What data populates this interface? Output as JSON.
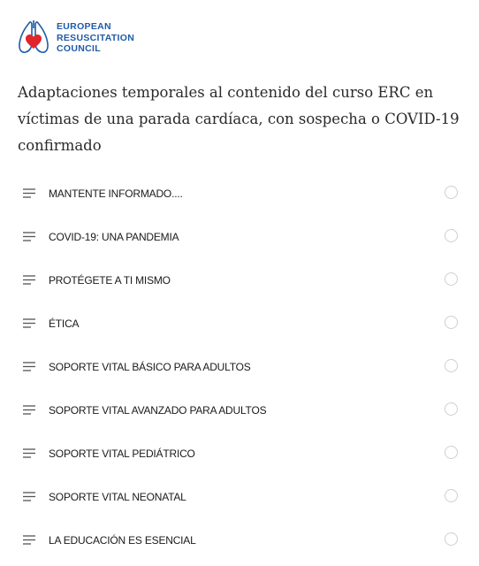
{
  "brand": {
    "line1": "EUROPEAN",
    "line2": "RESUSCITATION",
    "line3": "COUNCIL",
    "brand_color": "#1e5ba8",
    "heart_color": "#e0262b"
  },
  "course": {
    "title": "Adaptaciones temporales al contenido del curso ERC en víctimas de una parada cardíaca, con sospecha o COVID-19 confirmado"
  },
  "lessons": [
    {
      "label": "MANTENTE INFORMADO....",
      "icon": "lesson-lines-icon",
      "status": "incomplete"
    },
    {
      "label": "COVID-19: UNA PANDEMIA",
      "icon": "lesson-lines-icon",
      "status": "incomplete"
    },
    {
      "label": "PROTÉGETE A TI MISMO",
      "icon": "lesson-lines-icon",
      "status": "incomplete"
    },
    {
      "label": "ÉTICA",
      "icon": "lesson-lines-icon",
      "status": "incomplete"
    },
    {
      "label": "SOPORTE VITAL BÁSICO PARA ADULTOS",
      "icon": "lesson-lines-icon",
      "status": "incomplete"
    },
    {
      "label": "SOPORTE VITAL AVANZADO PARA ADULTOS",
      "icon": "lesson-lines-icon",
      "status": "incomplete"
    },
    {
      "label": "SOPORTE VITAL PEDIÁTRICO",
      "icon": "lesson-lines-icon",
      "status": "incomplete"
    },
    {
      "label": "SOPORTE VITAL NEONATAL",
      "icon": "lesson-lines-icon",
      "status": "incomplete"
    },
    {
      "label": "LA EDUCACIÓN ES ESENCIAL",
      "icon": "lesson-lines-icon",
      "status": "incomplete"
    }
  ]
}
